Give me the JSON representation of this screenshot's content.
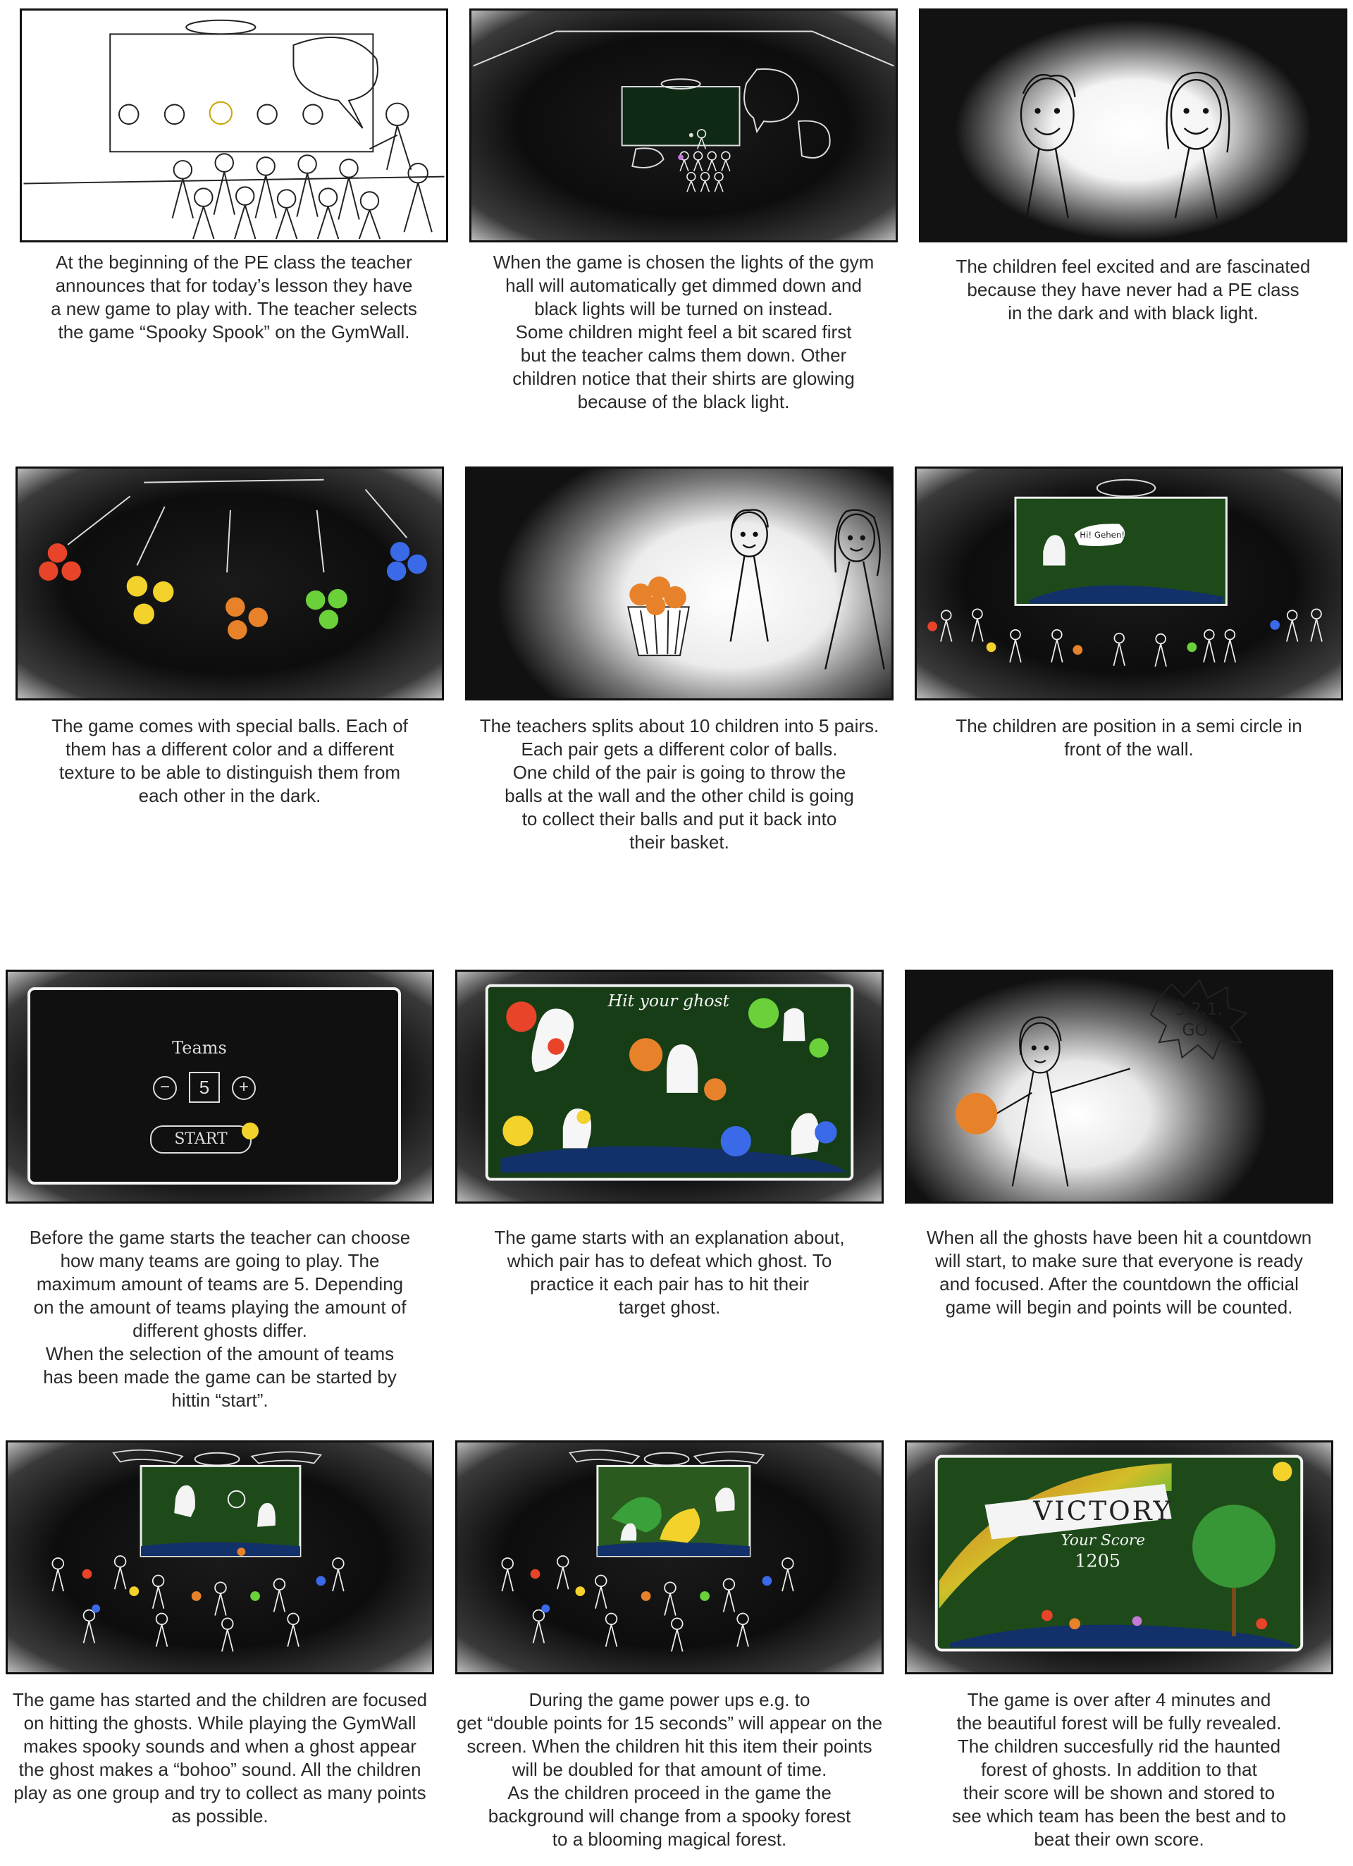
{
  "panels": [
    {
      "caption": "At the beginning of the PE class the teacher\nannounces that for today’s lesson they have\na new game to play with. The teacher selects\nthe game “Spooky Spook” on the GymWall."
    },
    {
      "caption": "When the game is chosen the lights of the gym\nhall will automatically get dimmed down and\nblack lights will be turned on instead.\nSome children might feel a bit scared first\nbut the teacher calms them down. Other\nchildren notice that their shirts are glowing\nbecause of the black light."
    },
    {
      "caption": "The children feel excited and are fascinated\nbecause they have never had a PE class\nin the dark and with black light."
    },
    {
      "caption": "The game comes with special balls. Each of\nthem has a different color and a different\ntexture to be able to distinguish them from\neach other in the dark."
    },
    {
      "caption": "The teachers splits about 10 children into 5 pairs.\nEach pair gets a different color of balls.\nOne child of the pair is going to throw the\nballs at the wall and the other child is going\nto collect their balls and put it back into\ntheir basket."
    },
    {
      "caption": "The children are position in a semi circle in\nfront of the wall.",
      "speech": "Hi! Gehen!"
    },
    {
      "caption": "Before the game starts the teacher can choose\nhow many teams are going to play. The\nmaximum amount of teams are 5. Depending\non the amount of teams playing the amount of\ndifferent ghosts differ.\nWhen the selection of the amount of teams\nhas been made the game can be started by\nhittin “start”.",
      "screen_title": "Teams",
      "minus": "−",
      "plus": "+",
      "team_count": "5",
      "start_label": "START"
    },
    {
      "caption": "The game starts with an explanation about,\nwhich pair has to defeat which ghost. To\npractice it each pair has to hit their\ntarget ghost.",
      "screen_text": "Hit your ghost"
    },
    {
      "caption": "When all the ghosts have been hit a countdown\nwill start, to make sure that everyone is ready\nand focused. After the countdown the official\ngame will begin and points will be counted.",
      "countdown": "3.2.1.",
      "go": "GO!"
    },
    {
      "caption": "The game has started and the children are focused\non hitting the ghosts. While playing the GymWall\nmakes spooky sounds and when a ghost appear\nthe ghost makes a “bohoo” sound. All the children\nplay as one group and try to collect as many points\nas possible."
    },
    {
      "caption": "During the game power ups e.g. to\nget “double points for 15 seconds” will appear on the\nscreen. When the children hit this item their points\nwill be doubled for that amount of time.\nAs the children proceed in the game the\nbackground will change from a spooky forest\nto a blooming magical forest."
    },
    {
      "caption": "The game is over after 4 minutes and\nthe beautiful forest will be fully revealed.\nThe children succesfully rid the haunted\nforest of ghosts. In addition to that\ntheir score will be shown and stored to\nsee which team has been the best and to\nbeat their own score.",
      "banner": "VICTORY",
      "score_label": "Your Score",
      "score": "1205"
    }
  ],
  "colors": {
    "ball_red": "#e8442a",
    "ball_yellow": "#f2d22b",
    "ball_orange": "#e8822a",
    "ball_green": "#6ad13a",
    "ball_blue": "#3a6ae8",
    "forest": "#1e4a1a"
  }
}
